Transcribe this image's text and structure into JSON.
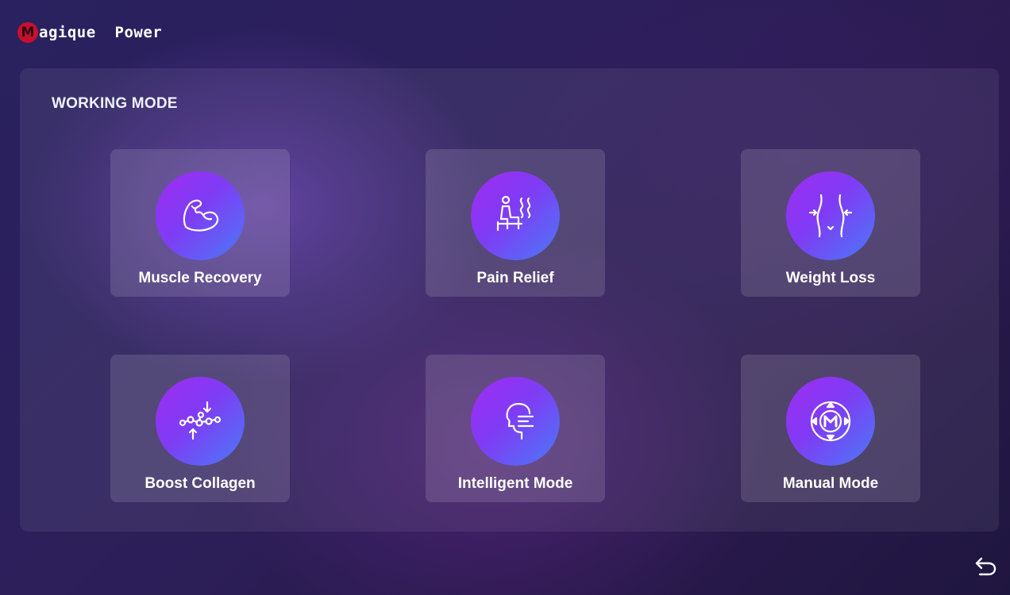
{
  "brand": {
    "mark": "M",
    "text": "agique  Power"
  },
  "panel": {
    "title": "WORKING MODE"
  },
  "modes": [
    {
      "label": "Muscle Recovery",
      "icon": "flexed-arm-icon"
    },
    {
      "label": "Pain Relief",
      "icon": "person-heat-icon"
    },
    {
      "label": "Weight Loss",
      "icon": "waist-slim-icon"
    },
    {
      "label": "Boost Collagen",
      "icon": "molecule-chain-icon"
    },
    {
      "label": "Intelligent Mode",
      "icon": "ai-head-icon"
    },
    {
      "label": "Manual Mode",
      "icon": "manual-dpad-icon"
    }
  ],
  "nav": {
    "back_icon": "back-arrow-icon"
  },
  "colors": {
    "icon_gradient_start": "#a02cf2",
    "icon_gradient_end": "#4a7af7",
    "logo_red": "#c8102e"
  }
}
